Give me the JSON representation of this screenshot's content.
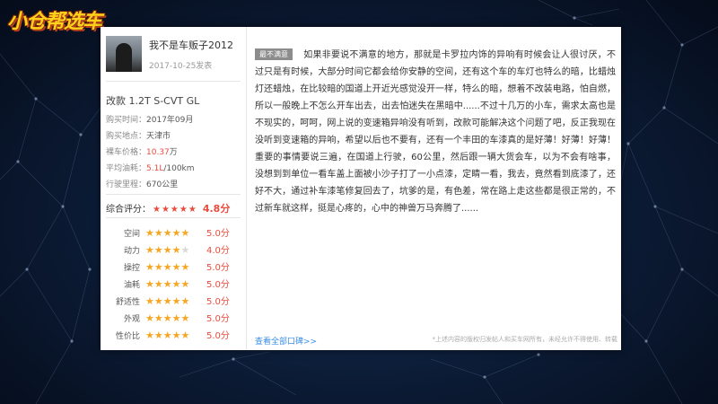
{
  "brand": {
    "logo_text": "小仓帮选车"
  },
  "user": {
    "username": "我不是车贩子2012",
    "post_date": "2017-10-25发表"
  },
  "car": {
    "model": "改款 1.2T S-CVT GL",
    "details": [
      {
        "label": "购买时间：",
        "value": "2017年09月",
        "suffix": ""
      },
      {
        "label": "购买地点：",
        "value": "天津市",
        "suffix": ""
      },
      {
        "label": "裸车价格：",
        "value": "10.37",
        "suffix": "万"
      },
      {
        "label": "平均油耗：",
        "value": "5.1L",
        "suffix": "/100km"
      },
      {
        "label": "行驶里程：",
        "value": "670公里",
        "suffix": ""
      }
    ]
  },
  "overall_rating": {
    "label": "综合评分：",
    "score": "4.8分",
    "stars": 4.8
  },
  "sub_ratings": [
    {
      "label": "空间",
      "score": "5.0分",
      "stars": 5
    },
    {
      "label": "动力",
      "score": "4.0分",
      "stars": 4
    },
    {
      "label": "操控",
      "score": "5.0分",
      "stars": 5
    },
    {
      "label": "油耗",
      "score": "5.0分",
      "stars": 5
    },
    {
      "label": "舒适性",
      "score": "5.0分",
      "stars": 5
    },
    {
      "label": "外观",
      "score": "5.0分",
      "stars": 5
    },
    {
      "label": "性价比",
      "score": "5.0分",
      "stars": 5
    }
  ],
  "review": {
    "tag": "最不满意",
    "text": "如果非要说不满意的地方，那就是卡罗拉内饰的异响有时候会让人很讨厌，不过只是有时候，大部分时间它都会给你安静的空间，还有这个车的车灯也特么的暗，比蜡烛灯还蜡烛，在比较暗的国道上开近光感觉没开一样，特么的暗，想着不改装电路，怕自燃，所以一般晚上不怎么开车出去，出去怕迷失在黑暗中......不过十几万的小车，需求太高也是不现实的，呵呵，网上说的变速箱异响没有听到，改款可能解决这个问题了吧，反正我现在没听到变速箱的异响，希望以后也不要有，还有一个丰田的车漆真的是好薄！好薄！好薄！重要的事情要说三遍，在国道上行驶，60公里，然后跟一辆大货会车，以为不会有啥事，没想到到单位一看车盖上面被小沙子打了一小点漆，定睛一看，我去，竟然看到底漆了，还好不大，通过补车漆笔修复回去了，坑爹的是，有色差，常在路上走这些都是很正常的，不过新车就这样，挺是心疼的，心中的神兽万马奔腾了......"
  },
  "footer": {
    "more_link": "查看全部口碑>>",
    "copyright": "*上述内容的版权归发帖人和买车网所有，未经允许不得使用、转载"
  },
  "colors": {
    "accent_red": "#e84c3d",
    "star_orange": "#f5a623",
    "link_blue": "#3a8ee6",
    "logo_yellow": "#ffd21a"
  }
}
